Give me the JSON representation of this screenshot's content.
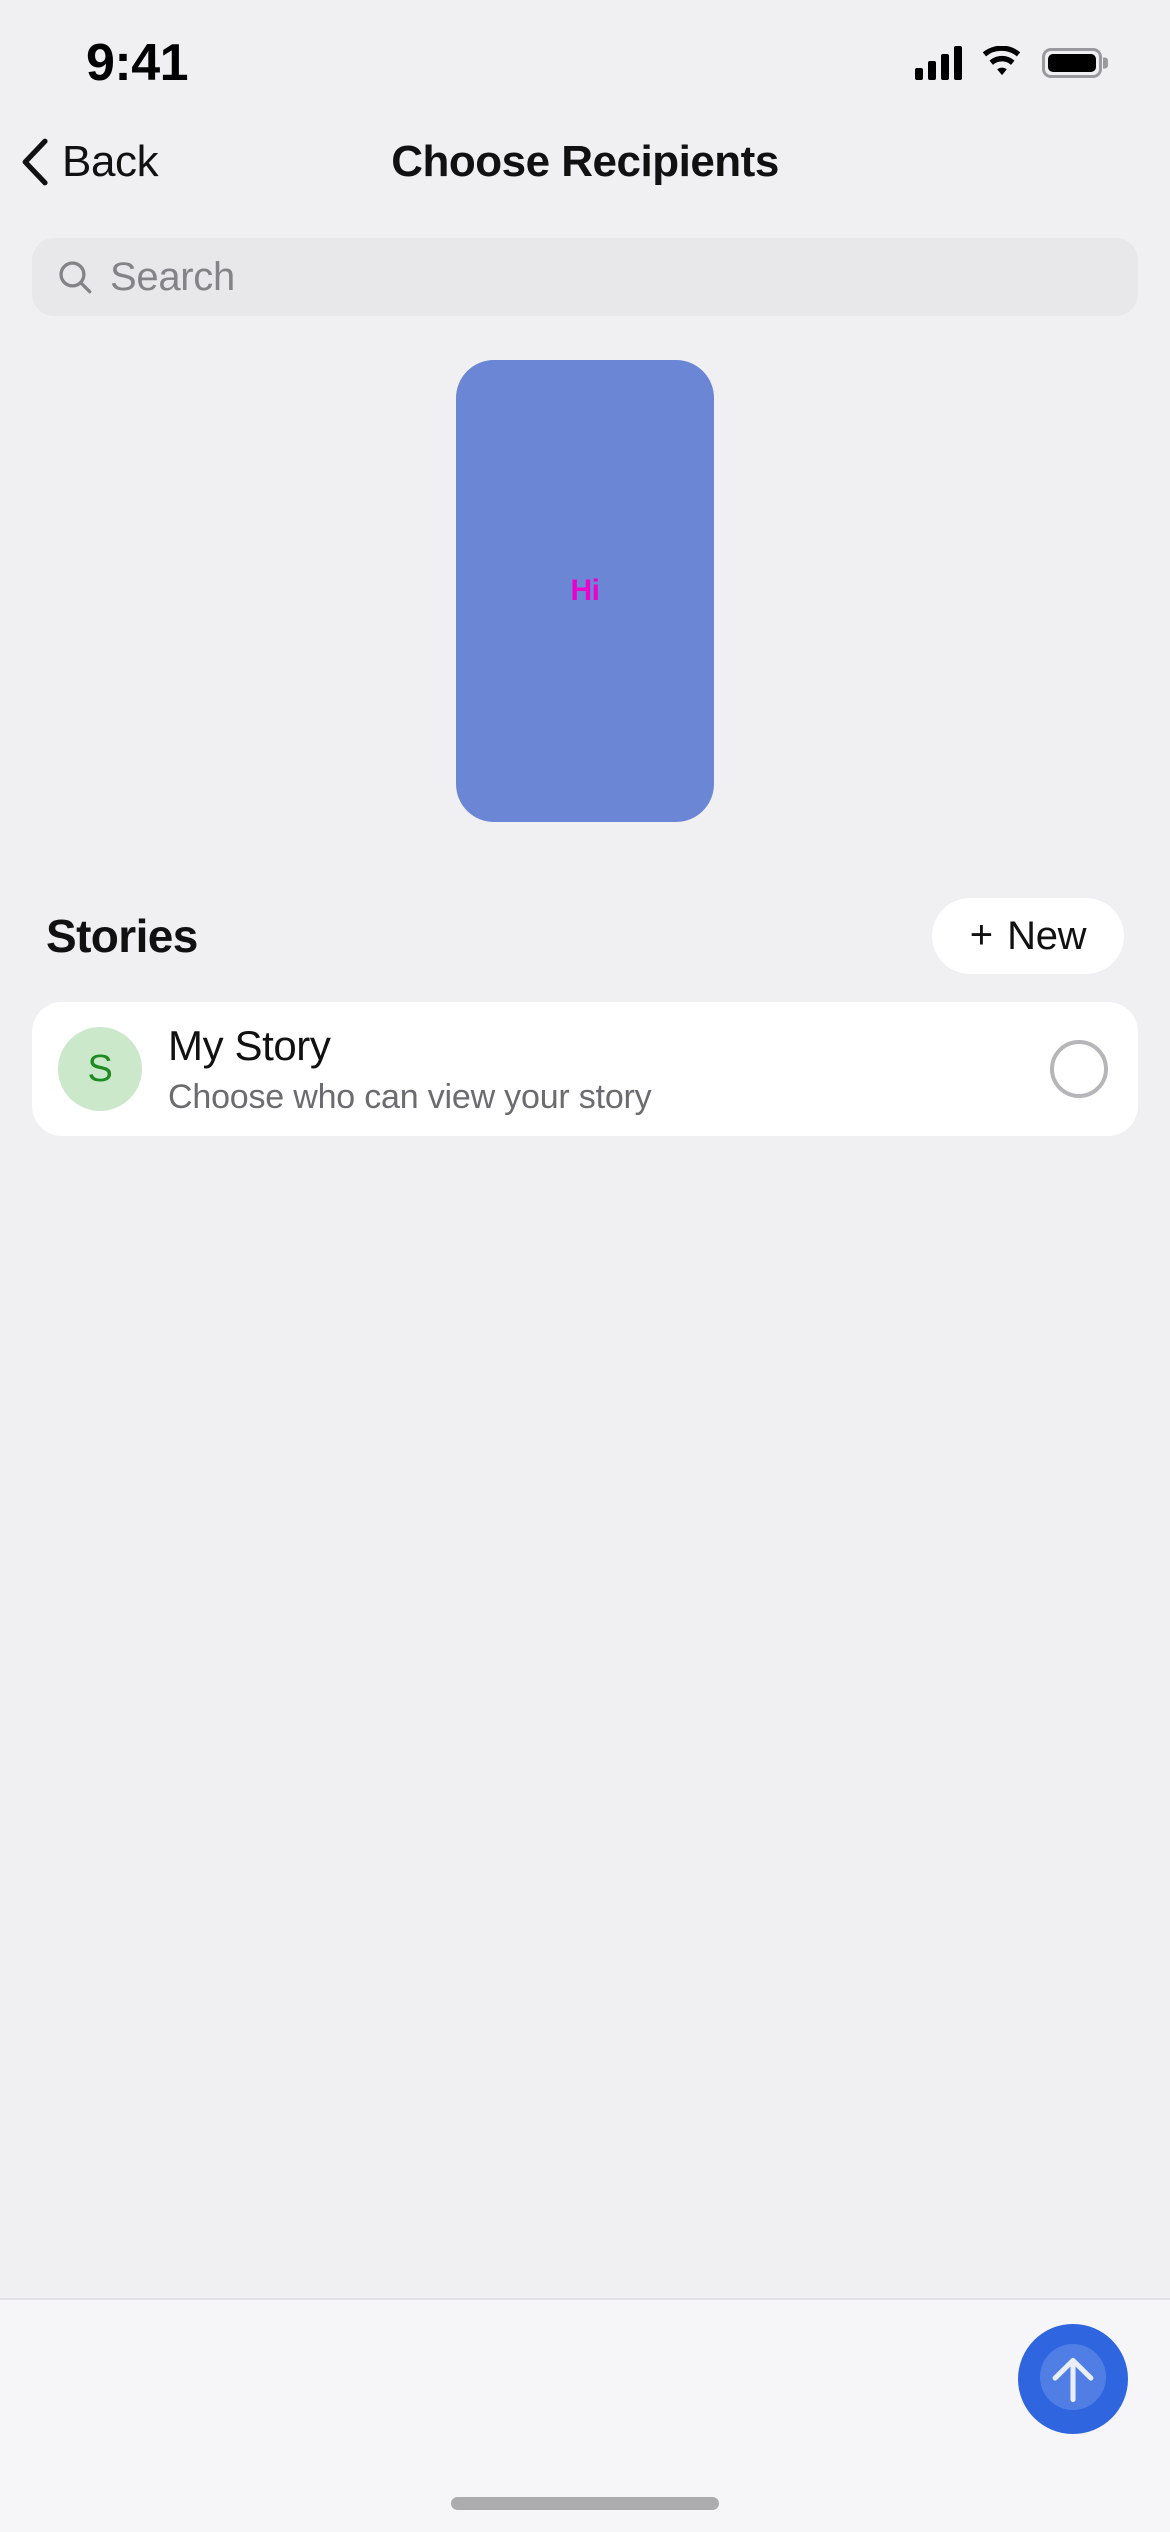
{
  "status_bar": {
    "time": "9:41",
    "cellular_icon": "cellular-signal-icon",
    "wifi_icon": "wifi-icon",
    "battery_icon": "battery-full-icon"
  },
  "nav_bar": {
    "back_label": "Back",
    "back_icon": "chevron-left-icon",
    "title": "Choose Recipients"
  },
  "search": {
    "icon": "search-icon",
    "placeholder": "Search",
    "value": ""
  },
  "preview": {
    "text": "Hi",
    "card_color": "#6B86D4",
    "text_color": "#EE00CC"
  },
  "stories": {
    "section_title": "Stories",
    "new_button": {
      "plus_icon": "plus-icon",
      "label": "New"
    },
    "items": [
      {
        "avatar_initial": "S",
        "avatar_bg": "#CBE8CB",
        "avatar_fg": "#1F8B22",
        "title": "My Story",
        "subtitle": "Choose who can view your story",
        "selected": false
      }
    ]
  },
  "bottom_bar": {
    "send_button": {
      "icon": "arrow-up-icon",
      "color": "#2F66E0"
    },
    "home_indicator": "home-indicator"
  }
}
